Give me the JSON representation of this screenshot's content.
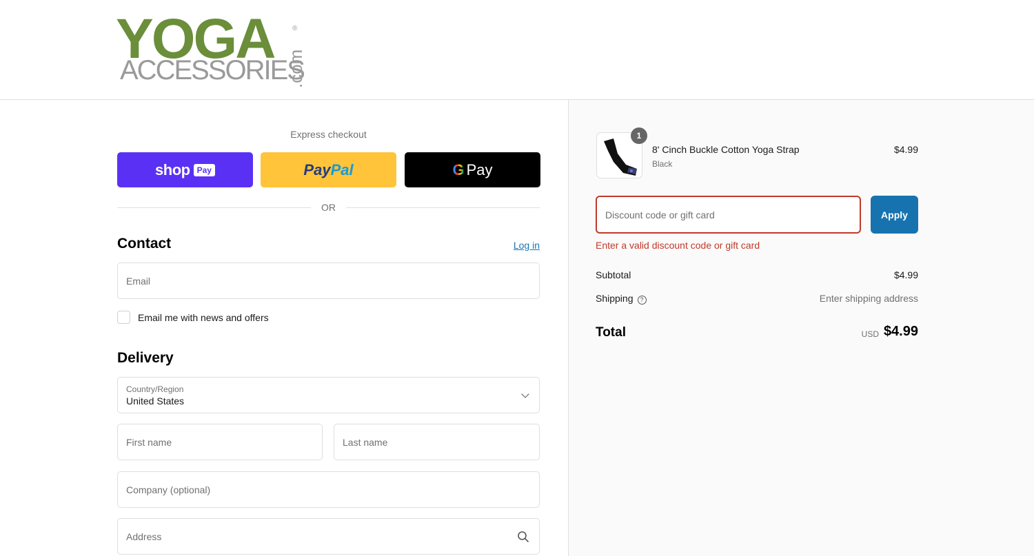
{
  "brand": {
    "logo_main": "YOGA",
    "logo_sub": "ACCESSORIES",
    "logo_suffix": ".com",
    "logo_reg": "®"
  },
  "express": {
    "label": "Express checkout",
    "shop_text": "shop",
    "shop_pay": "Pay",
    "paypal_1": "Pay",
    "paypal_2": "Pal",
    "gpay_g": "G",
    "gpay_text": "Pay"
  },
  "divider": {
    "or": "OR"
  },
  "contact": {
    "title": "Contact",
    "login": "Log in",
    "email_placeholder": "Email",
    "newsletter_label": "Email me with news and offers"
  },
  "delivery": {
    "title": "Delivery",
    "country_label": "Country/Region",
    "country_value": "United States",
    "first_name_placeholder": "First name",
    "last_name_placeholder": "Last name",
    "company_placeholder": "Company (optional)",
    "address_placeholder": "Address"
  },
  "cart": {
    "item": {
      "name": "8' Cinch Buckle Cotton Yoga Strap",
      "variant": "Black",
      "price": "$4.99",
      "quantity": "1"
    },
    "discount_placeholder": "Discount code or gift card",
    "apply_label": "Apply",
    "error": "Enter a valid discount code or gift card",
    "subtotal_label": "Subtotal",
    "subtotal_value": "$4.99",
    "shipping_label": "Shipping",
    "shipping_value": "Enter shipping address",
    "total_label": "Total",
    "total_currency": "USD",
    "total_value": "$4.99"
  },
  "colors": {
    "brand_green": "#6b8e3a",
    "shop_purple": "#5a31f4",
    "paypal_yellow": "#ffc439",
    "apply_blue": "#1773b0",
    "error_red": "#c0392b"
  }
}
